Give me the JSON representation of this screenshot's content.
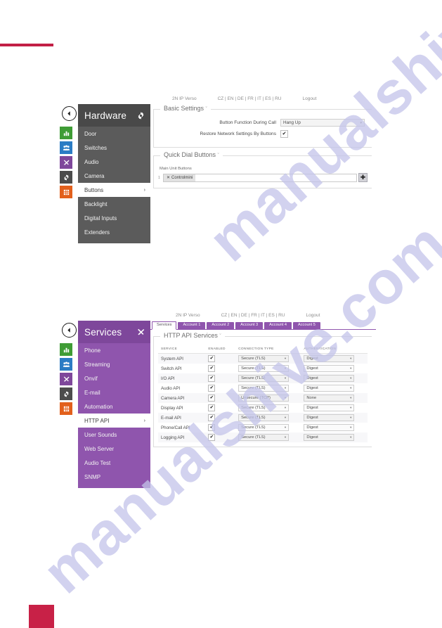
{
  "decor": {
    "top_rule_color": "#c21f45",
    "bottom_square_color": "#c82147"
  },
  "watermark": {
    "line1": "manualshive.com",
    "line2": "manualshive.com",
    "color": "#c3c4ea"
  },
  "panels": [
    {
      "id": "hardware",
      "theme": "dark",
      "topbar": {
        "product": "2N IP Verso",
        "languages": "CZ | EN | DE | FR | IT | ES | RU",
        "logout": "Logout"
      },
      "menu": {
        "title": "Hardware",
        "head_icon": "gear-icon",
        "items": [
          {
            "label": "Door",
            "active": false,
            "chevron": ""
          },
          {
            "label": "Switches",
            "active": false,
            "chevron": ""
          },
          {
            "label": "Audio",
            "active": false,
            "chevron": ""
          },
          {
            "label": "Camera",
            "active": false,
            "chevron": ""
          },
          {
            "label": "Buttons",
            "active": true,
            "chevron": "›"
          },
          {
            "label": "Backlight",
            "active": false,
            "chevron": ""
          },
          {
            "label": "Digital Inputs",
            "active": false,
            "chevron": ""
          },
          {
            "label": "Extenders",
            "active": false,
            "chevron": ""
          }
        ]
      },
      "rail": [
        {
          "name": "statistics-icon",
          "color": "#3f9c35"
        },
        {
          "name": "users-icon",
          "color": "#2b7cc4"
        },
        {
          "name": "tools-icon",
          "color": "#7e479b"
        },
        {
          "name": "gear-icon",
          "color": "#4c4c4c"
        },
        {
          "name": "grid-icon",
          "color": "#e2601c"
        }
      ],
      "sections": {
        "basic": {
          "title": "Basic Settings",
          "caret": "ˇ",
          "rows": [
            {
              "label": "Button Function During Call",
              "type": "select",
              "value": "Hang Up"
            },
            {
              "label": "Restore Network Settings By Buttons",
              "type": "checkbox",
              "checked": true
            }
          ]
        },
        "quickdial": {
          "title": "Quick Dial Buttons",
          "caret": "ˇ",
          "sub_label": "Main Unit Buttons",
          "row_index": "1",
          "tag": "Controlmini",
          "tag_remove": "✕",
          "add_button": "✚"
        }
      }
    },
    {
      "id": "services",
      "theme": "purple",
      "topbar": {
        "product": "2N IP Verso",
        "languages": "CZ | EN | DE | FR | IT | ES | RU",
        "logout": "Logout"
      },
      "menu": {
        "title": "Services",
        "head_icon": "tools-icon",
        "items": [
          {
            "label": "Phone",
            "active": false,
            "chevron": ""
          },
          {
            "label": "Streaming",
            "active": false,
            "chevron": ""
          },
          {
            "label": "Onvif",
            "active": false,
            "chevron": ""
          },
          {
            "label": "E-mail",
            "active": false,
            "chevron": ""
          },
          {
            "label": "Automation",
            "active": false,
            "chevron": ""
          },
          {
            "label": "HTTP API",
            "active": true,
            "chevron": "›"
          },
          {
            "label": "User Sounds",
            "active": false,
            "chevron": ""
          },
          {
            "label": "Web Server",
            "active": false,
            "chevron": ""
          },
          {
            "label": "Audio Test",
            "active": false,
            "chevron": ""
          },
          {
            "label": "SNMP",
            "active": false,
            "chevron": ""
          }
        ]
      },
      "rail": [
        {
          "name": "statistics-icon",
          "color": "#3f9c35"
        },
        {
          "name": "users-icon",
          "color": "#2b7cc4"
        },
        {
          "name": "tools-icon",
          "color": "#7e479b"
        },
        {
          "name": "gear-icon",
          "color": "#4c4c4c"
        },
        {
          "name": "grid-icon",
          "color": "#e2601c"
        }
      ],
      "tabs": [
        {
          "label": "Services",
          "active": true
        },
        {
          "label": "Account 1",
          "active": false
        },
        {
          "label": "Account 2",
          "active": false
        },
        {
          "label": "Account 3",
          "active": false
        },
        {
          "label": "Account 4",
          "active": false
        },
        {
          "label": "Account 5",
          "active": false
        }
      ],
      "section": {
        "title": "HTTP API Services",
        "caret": "ˇ",
        "columns": [
          "SERVICE",
          "ENABLED",
          "CONNECTION TYPE",
          "AUTHENTICATION"
        ],
        "rows": [
          {
            "service": "System API",
            "enabled": true,
            "connection": "Secure (TLS)",
            "auth": "Digest"
          },
          {
            "service": "Switch API",
            "enabled": true,
            "connection": "Secure (TLS)",
            "auth": "Digest"
          },
          {
            "service": "I/O API",
            "enabled": true,
            "connection": "Secure (TLS)",
            "auth": "Digest"
          },
          {
            "service": "Audio API",
            "enabled": true,
            "connection": "Secure (TLS)",
            "auth": "Digest"
          },
          {
            "service": "Camera API",
            "enabled": true,
            "connection": "Unsecure (TCP)",
            "auth": "None"
          },
          {
            "service": "Display API",
            "enabled": true,
            "connection": "Secure (TLS)",
            "auth": "Digest"
          },
          {
            "service": "E-mail API",
            "enabled": true,
            "connection": "Secure (TLS)",
            "auth": "Digest"
          },
          {
            "service": "Phone/Call API",
            "enabled": true,
            "connection": "Secure (TLS)",
            "auth": "Digest"
          },
          {
            "service": "Logging API",
            "enabled": true,
            "connection": "Secure (TLS)",
            "auth": "Digest"
          }
        ],
        "check_glyph": "✔",
        "arrow_glyph": "▾"
      }
    }
  ]
}
